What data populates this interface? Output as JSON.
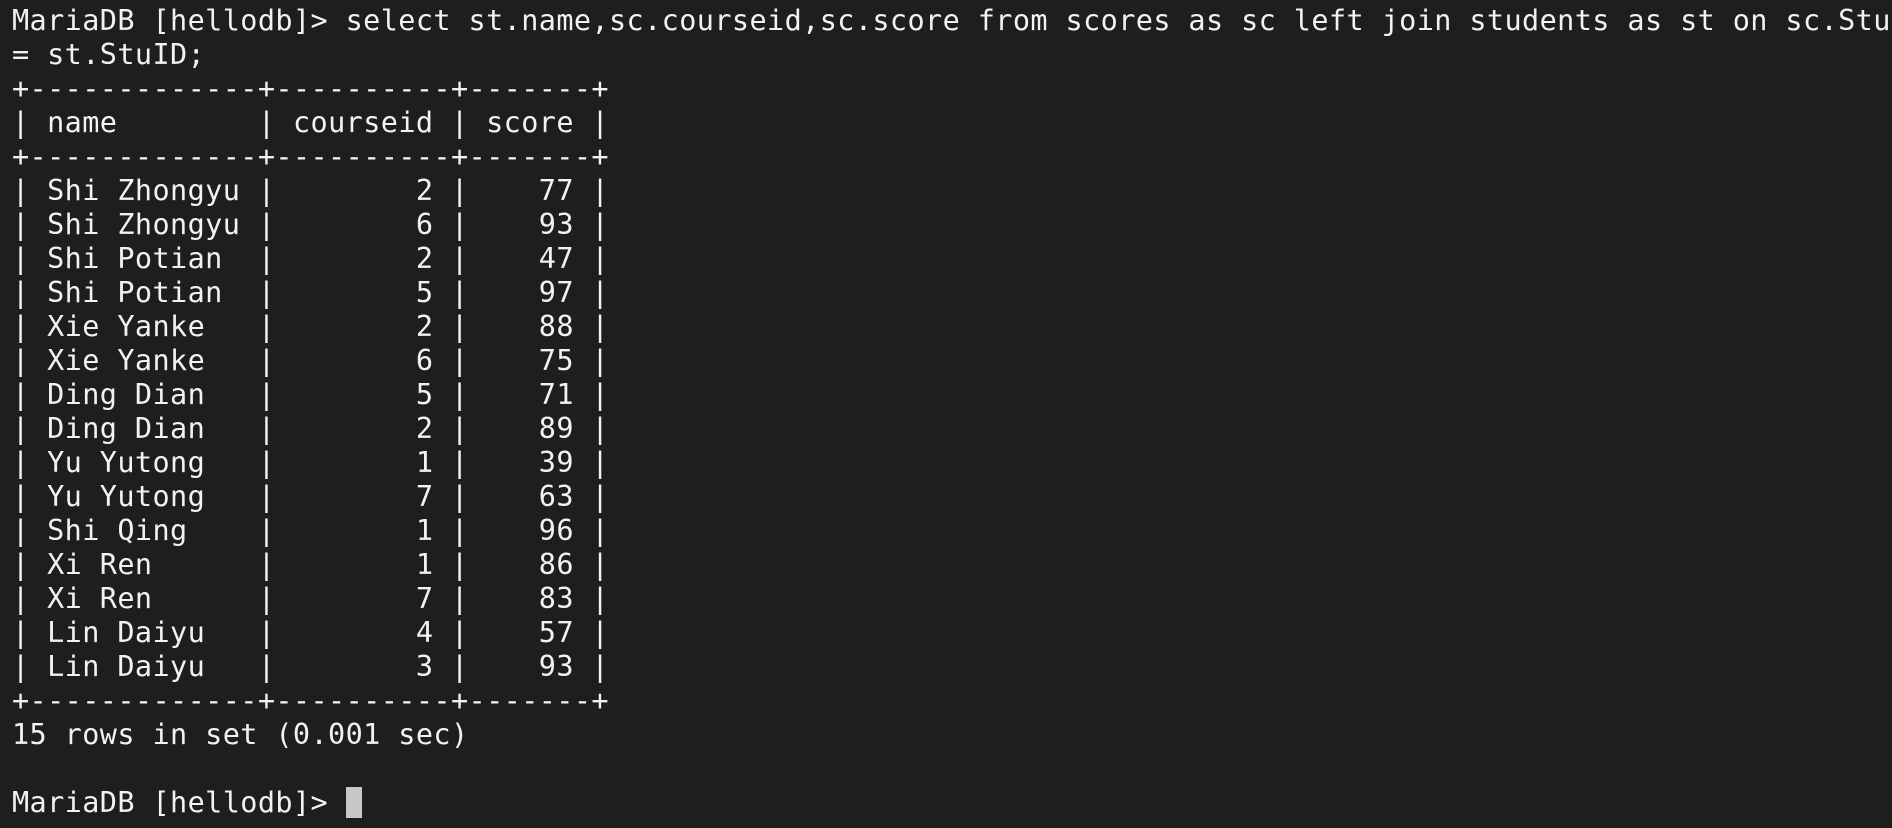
{
  "terminal": {
    "prompt": "MariaDB [hellodb]> ",
    "command": [
      "select st.name,sc.courseid,sc.score from scores as sc left join students as st on sc.StuID",
      "= st.StuID;"
    ],
    "table": {
      "border": "+-------------+----------+-------+",
      "columns": [
        "name",
        "courseid",
        "score"
      ],
      "rows": [
        [
          "Shi Zhongyu",
          "2",
          "77"
        ],
        [
          "Shi Zhongyu",
          "6",
          "93"
        ],
        [
          "Shi Potian",
          "2",
          "47"
        ],
        [
          "Shi Potian",
          "5",
          "97"
        ],
        [
          "Xie Yanke",
          "2",
          "88"
        ],
        [
          "Xie Yanke",
          "6",
          "75"
        ],
        [
          "Ding Dian",
          "5",
          "71"
        ],
        [
          "Ding Dian",
          "2",
          "89"
        ],
        [
          "Yu Yutong",
          "1",
          "39"
        ],
        [
          "Yu Yutong",
          "7",
          "63"
        ],
        [
          "Shi Qing",
          "1",
          "96"
        ],
        [
          "Xi Ren",
          "1",
          "86"
        ],
        [
          "Xi Ren",
          "7",
          "83"
        ],
        [
          "Lin Daiyu",
          "4",
          "57"
        ],
        [
          "Lin Daiyu",
          "3",
          "93"
        ]
      ]
    },
    "result_summary": "15 rows in set (0.001 sec)",
    "final_prompt": "MariaDB [hellodb]> "
  }
}
